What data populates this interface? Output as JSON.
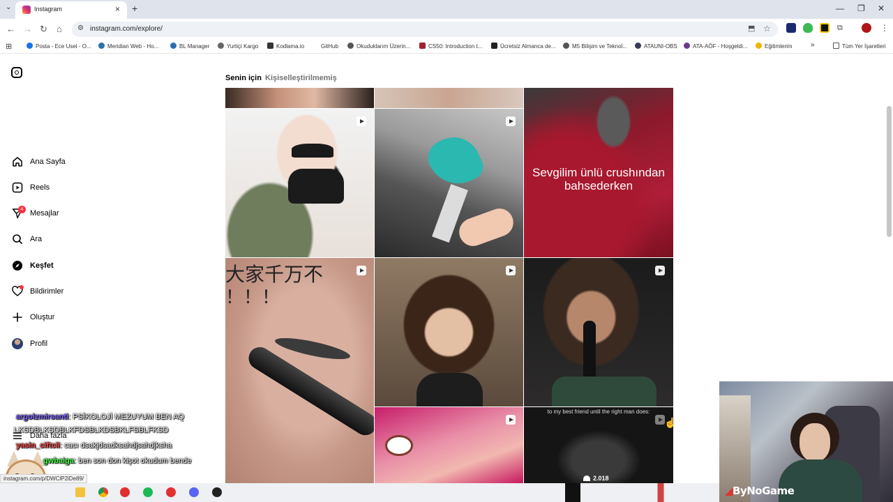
{
  "browser": {
    "tab_title": "Instagram",
    "url": "instagram.com/explore/",
    "bookmarks": [
      "Posta - Ece Usel - O...",
      "Meridian Web - Ho...",
      "BL Manager",
      "Yurtiçi Kargo",
      "Kodlama.io",
      "GitHub",
      "Okuduklarım Üzerin...",
      "CS50: Introduction t...",
      "Ücretsiz Almanca de...",
      "M5 Bilişim ve Teknol...",
      "ATAUNI-OBS",
      "ATA-AÖF - Hoşgeldi...",
      "Eğitimlerim"
    ],
    "all_bookmarks": "Tüm Yer İşaretleri",
    "more_bookmarks": "»",
    "status_url": "instagram.com/p/DWClP2iDe89/"
  },
  "sidebar": {
    "home": "Ana Sayfa",
    "reels": "Reels",
    "messages": "Mesajlar",
    "messages_badge": "4",
    "search": "Ara",
    "explore": "Keşfet",
    "notifications": "Bildirimler",
    "create": "Oluştur",
    "profile": "Profil",
    "more": "Daha fazla"
  },
  "explore": {
    "tab_for_you": "Senin için",
    "tab_unpersonalized": "Kişiselleştirilmemiş",
    "tile_text_1": "Sevgilim ünlü crushından bahsederken",
    "tile_text_2": "大家千万不",
    "tile_text_3": "！！！",
    "tile_text_4": "to my best friend until the right man does:",
    "tile_views": "2.018"
  },
  "chat": [
    {
      "user": "argolzmirsanti",
      "msg": ": PSİKOLOJİ MEZUYUM BEN AQ"
    },
    {
      "user": "",
      "msg": "LKSDBLKSDBLKFDSBLKDSBKLFSBLFKSD"
    },
    {
      "user": "yasin_ciftcii",
      "msg": ": cacı dsakjdsadksahdjsahdjksha"
    },
    {
      "user": "gwbaiga",
      "msg": ": ben son don kişot okudum bende"
    }
  ],
  "webcam": {
    "watermark": "ByNoGame"
  },
  "colors": {
    "badge": "#ff3040",
    "chat_user_1": "#7c62ff",
    "chat_user_2": "#ff4a4a",
    "chat_user_3": "#4cff4c"
  }
}
